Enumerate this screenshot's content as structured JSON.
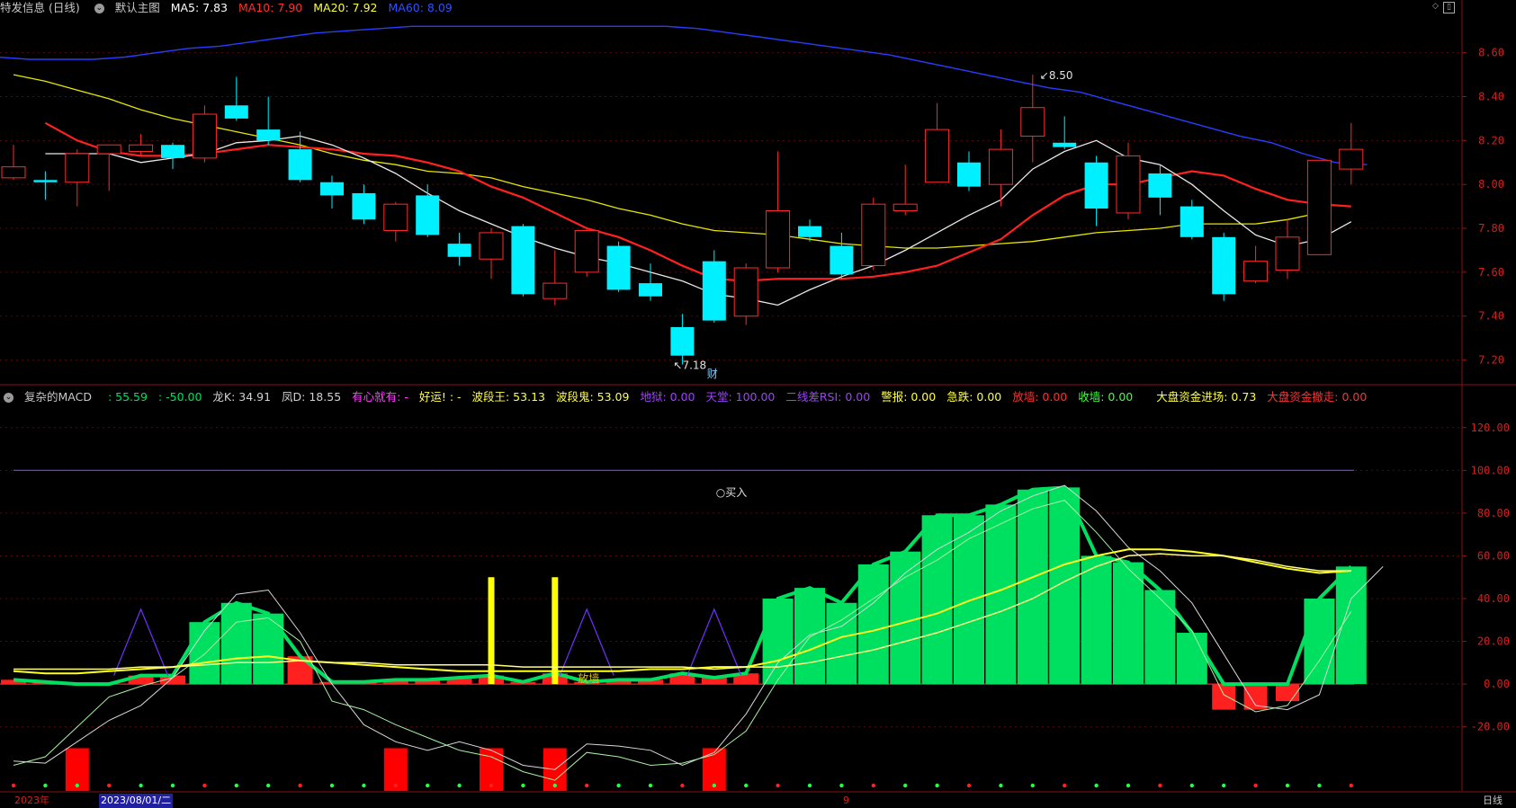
{
  "header": {
    "stock_name": "特发信息 (日线)",
    "main_chart": "默认主图",
    "ma": [
      {
        "label": "MA5: 7.83",
        "color": "#ffffff"
      },
      {
        "label": "MA10: 7.90",
        "color": "#ff3030"
      },
      {
        "label": "MA20: 7.92",
        "color": "#ffff30"
      },
      {
        "label": "MA60: 8.09",
        "color": "#3050ff"
      }
    ]
  },
  "price_axis": {
    "min": 7.1,
    "max": 8.75,
    "ticks": [
      "8.60",
      "8.40",
      "8.20",
      "8.00",
      "7.80",
      "7.60",
      "7.40",
      "7.20"
    ]
  },
  "annotations": {
    "high": "8.50",
    "low": "7.18",
    "cai": "财",
    "buy": "买入",
    "fangzhang": "放墙"
  },
  "indicator_header": {
    "name": "复杂的MACD",
    "items": [
      {
        "label": ": 55.59",
        "color": "#00e060"
      },
      {
        "label": ": -50.00",
        "color": "#00e060"
      },
      {
        "label": "龙K: 34.91",
        "color": "#d0d0d0"
      },
      {
        "label": "凤D: 18.55",
        "color": "#d0d0d0"
      },
      {
        "label": "有心就有: -",
        "color": "#ff40ff"
      },
      {
        "label": "好运! : -",
        "color": "#ffff40"
      },
      {
        "label": "波段王: 53.13",
        "color": "#ffff40"
      },
      {
        "label": "波段鬼: 53.09",
        "color": "#ffff40"
      },
      {
        "label": "地狱: 0.00",
        "color": "#a040ff"
      },
      {
        "label": "天堂: 100.00",
        "color": "#a040ff"
      },
      {
        "label": "二线差RSI: 0.00",
        "color": "#a040ff"
      },
      {
        "label": "警报: 0.00",
        "color": "#ffff40"
      },
      {
        "label": "急跌: 0.00",
        "color": "#ffff40"
      },
      {
        "label": "放墙: 0.00",
        "color": "#ff3030"
      },
      {
        "label": "收墙: 0.00",
        "color": "#40ff40"
      },
      {
        "label": "大盘资金进场: 0.73",
        "color": "#ffff40"
      },
      {
        "label": "大盘资金撤走: 0.00",
        "color": "#ff3030"
      }
    ]
  },
  "indicator_axis": {
    "min": -50,
    "max": 130,
    "ticks": [
      "120.00",
      "100.00",
      "80.00",
      "60.00",
      "40.00",
      "20.00",
      "0.00",
      "-20.00"
    ]
  },
  "bottom_bar": {
    "year": "2023年",
    "date": "2023/08/01/二",
    "marker": "9",
    "period": "日线"
  },
  "chart_data": {
    "type": "candlestick",
    "candles_ohlc": [
      [
        8.03,
        8.08,
        8.18,
        8.02
      ],
      [
        8.02,
        8.01,
        8.06,
        7.93
      ],
      [
        8.01,
        8.14,
        8.16,
        7.9
      ],
      [
        8.14,
        8.18,
        8.18,
        7.97
      ],
      [
        8.15,
        8.18,
        8.23,
        8.13
      ],
      [
        8.18,
        8.12,
        8.19,
        8.07
      ],
      [
        8.12,
        8.32,
        8.36,
        8.1
      ],
      [
        8.36,
        8.3,
        8.49,
        8.29
      ],
      [
        8.25,
        8.2,
        8.4,
        8.18
      ],
      [
        8.16,
        8.02,
        8.24,
        8.01
      ],
      [
        8.01,
        7.95,
        8.04,
        7.89
      ],
      [
        7.96,
        7.84,
        8.0,
        7.82
      ],
      [
        7.79,
        7.91,
        7.92,
        7.74
      ],
      [
        7.95,
        7.77,
        8.0,
        7.76
      ],
      [
        7.73,
        7.67,
        7.78,
        7.63
      ],
      [
        7.66,
        7.78,
        7.8,
        7.57
      ],
      [
        7.81,
        7.5,
        7.82,
        7.49
      ],
      [
        7.48,
        7.55,
        7.7,
        7.45
      ],
      [
        7.6,
        7.79,
        7.8,
        7.58
      ],
      [
        7.72,
        7.52,
        7.74,
        7.51
      ],
      [
        7.55,
        7.49,
        7.64,
        7.47
      ],
      [
        7.35,
        7.22,
        7.41,
        7.18
      ],
      [
        7.65,
        7.38,
        7.7,
        7.37
      ],
      [
        7.4,
        7.62,
        7.64,
        7.36
      ],
      [
        7.62,
        7.88,
        8.15,
        7.6
      ],
      [
        7.81,
        7.76,
        7.84,
        7.74
      ],
      [
        7.72,
        7.59,
        7.78,
        7.57
      ],
      [
        7.63,
        7.91,
        7.94,
        7.61
      ],
      [
        7.88,
        7.91,
        8.09,
        7.86
      ],
      [
        8.01,
        8.25,
        8.37,
        8.01
      ],
      [
        8.1,
        7.99,
        8.15,
        7.97
      ],
      [
        8.0,
        8.16,
        8.25,
        7.9
      ],
      [
        8.22,
        8.35,
        8.5,
        8.1
      ],
      [
        8.19,
        8.17,
        8.31,
        8.16
      ],
      [
        8.1,
        7.89,
        8.13,
        7.81
      ],
      [
        7.87,
        8.13,
        8.19,
        7.84
      ],
      [
        8.05,
        7.94,
        8.09,
        7.86
      ],
      [
        7.9,
        7.76,
        7.93,
        7.75
      ],
      [
        7.76,
        7.5,
        7.78,
        7.47
      ],
      [
        7.56,
        7.65,
        7.72,
        7.55
      ],
      [
        7.61,
        7.76,
        7.84,
        7.57
      ],
      [
        7.68,
        8.11,
        8.11,
        7.68
      ],
      [
        8.07,
        8.16,
        8.28,
        8.0
      ]
    ],
    "ma5": [
      8.14,
      8.14,
      8.14,
      8.1,
      8.12,
      8.14,
      8.19,
      8.2,
      8.22,
      8.18,
      8.12,
      8.05,
      7.96,
      7.88,
      7.82,
      7.76,
      7.71,
      7.67,
      7.64,
      7.6,
      7.56,
      7.5,
      7.48,
      7.45,
      7.52,
      7.58,
      7.63,
      7.7,
      7.78,
      7.86,
      7.93,
      8.07,
      8.15,
      8.2,
      8.12,
      8.09,
      8.0,
      7.88,
      7.77,
      7.72,
      7.75,
      7.83
    ],
    "ma10": [
      8.28,
      8.2,
      8.15,
      8.13,
      8.13,
      8.14,
      8.16,
      8.18,
      8.17,
      8.16,
      8.14,
      8.13,
      8.1,
      8.06,
      7.99,
      7.94,
      7.87,
      7.8,
      7.76,
      7.7,
      7.63,
      7.57,
      7.56,
      7.57,
      7.57,
      7.57,
      7.58,
      7.6,
      7.63,
      7.69,
      7.75,
      7.86,
      7.95,
      8.0,
      8.0,
      8.03,
      8.06,
      8.04,
      7.98,
      7.93,
      7.91,
      7.9
    ],
    "ma20": [
      8.5,
      8.47,
      8.43,
      8.39,
      8.34,
      8.3,
      8.27,
      8.24,
      8.21,
      8.18,
      8.14,
      8.11,
      8.09,
      8.06,
      8.05,
      8.03,
      7.99,
      7.96,
      7.93,
      7.89,
      7.86,
      7.82,
      7.79,
      7.78,
      7.77,
      7.75,
      7.73,
      7.72,
      7.71,
      7.71,
      7.72,
      7.73,
      7.74,
      7.76,
      7.78,
      7.79,
      7.8,
      7.82,
      7.82,
      7.82,
      7.84,
      7.87
    ],
    "ma60": [
      8.58,
      8.57,
      8.57,
      8.57,
      8.58,
      8.6,
      8.62,
      8.63,
      8.65,
      8.67,
      8.69,
      8.7,
      8.71,
      8.72,
      8.72,
      8.72,
      8.72,
      8.72,
      8.72,
      8.72,
      8.72,
      8.72,
      8.71,
      8.69,
      8.67,
      8.65,
      8.63,
      8.61,
      8.59,
      8.56,
      8.53,
      8.5,
      8.47,
      8.44,
      8.42,
      8.38,
      8.34,
      8.3,
      8.26,
      8.22,
      8.19,
      8.14,
      8.1,
      8.09
    ],
    "macd_histogram": [
      2,
      1,
      0,
      0,
      4,
      4,
      29,
      38,
      33,
      13,
      1,
      1,
      2,
      2,
      3,
      4,
      1,
      5,
      1,
      2,
      2,
      5,
      3,
      5,
      40,
      45,
      38,
      56,
      62,
      79,
      79,
      84,
      91,
      92,
      60,
      57,
      44,
      24,
      -12,
      -12,
      -8,
      40,
      55
    ],
    "indicator_lines": {
      "white1": [
        -36,
        -37,
        -27,
        -17,
        -10,
        3,
        25,
        42,
        44,
        24,
        0,
        -19,
        -27,
        -31,
        -27,
        -31,
        -38,
        -40,
        -28,
        -29,
        -31,
        -38,
        -32,
        -14,
        10,
        23,
        27,
        38,
        52,
        63,
        71,
        81,
        88,
        93,
        81,
        64,
        53,
        38,
        14,
        -10,
        -12,
        -5,
        40,
        55
      ],
      "white2": [
        -38,
        -34,
        -20,
        -6,
        -1,
        3,
        14,
        29,
        31,
        20,
        -8,
        -12,
        -19,
        -25,
        -31,
        -34,
        -41,
        -45,
        -32,
        -34,
        -38,
        -37,
        -33,
        -22,
        2,
        22,
        30,
        40,
        50,
        58,
        68,
        75,
        82,
        86,
        71,
        54,
        40,
        25,
        -5,
        -13,
        -10,
        11,
        34
      ],
      "yellow_a": [
        6,
        5,
        5,
        6,
        7,
        8,
        10,
        12,
        13,
        11,
        10,
        9,
        8,
        7,
        6,
        6,
        6,
        6,
        6,
        6,
        7,
        7,
        8,
        8,
        11,
        16,
        22,
        25,
        29,
        33,
        39,
        44,
        50,
        56,
        60,
        63,
        63,
        62,
        60,
        57,
        54,
        52,
        53
      ],
      "yellow_b": [
        7,
        7,
        7,
        7,
        8,
        8,
        9,
        10,
        10,
        11,
        10,
        10,
        9,
        9,
        9,
        9,
        8,
        8,
        8,
        8,
        8,
        8,
        7,
        8,
        8,
        10,
        13,
        16,
        20,
        24,
        29,
        34,
        40,
        48,
        55,
        60,
        61,
        60,
        60,
        58,
        55,
        53,
        53
      ]
    }
  }
}
